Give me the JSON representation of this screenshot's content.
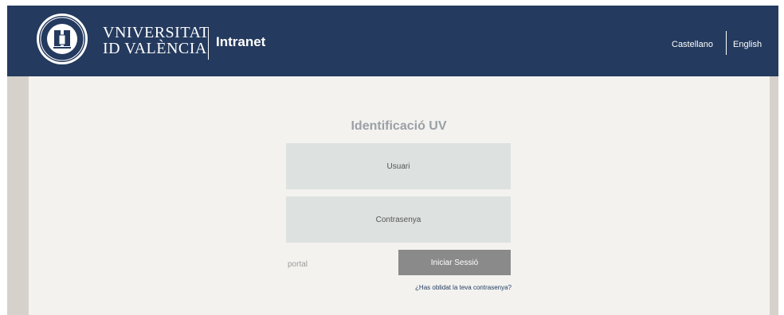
{
  "header": {
    "university_line1": "VNIVERSITAT",
    "university_line2": "ID VALÈNCIA",
    "app_name": "Intranet",
    "languages": [
      "Castellano",
      "English"
    ],
    "background_color": "#243a5e"
  },
  "login": {
    "title": "Identificació UV",
    "username_placeholder": "Usuari",
    "password_placeholder": "Contrasenya",
    "portal_text": "portal",
    "submit_label": "Iniciar Sessió",
    "forgot_password_link": "¿Has oblidat la teva contrasenya?"
  },
  "icons": {
    "logo": "university-seal-icon"
  }
}
